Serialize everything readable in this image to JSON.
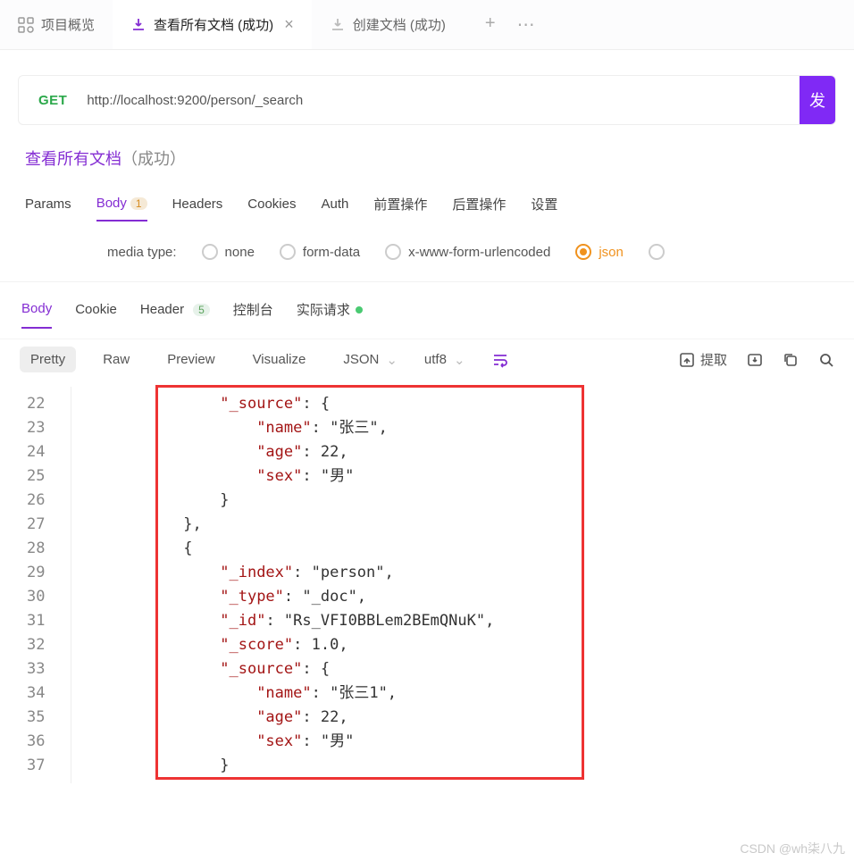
{
  "tabs": {
    "overview": "项目概览",
    "active": "查看所有文档 (成功)",
    "third": "创建文档 (成功)"
  },
  "request": {
    "method": "GET",
    "url": "http://localhost:9200/person/_search",
    "send": "发"
  },
  "name": {
    "main": "查看所有文档",
    "suffix": "（成功）"
  },
  "reqTabs": {
    "params": "Params",
    "body": "Body",
    "bodyBadge": "1",
    "headers": "Headers",
    "cookies": "Cookies",
    "auth": "Auth",
    "pre": "前置操作",
    "post": "后置操作",
    "settings": "设置"
  },
  "media": {
    "label": "media type:",
    "none": "none",
    "formdata": "form-data",
    "xwww": "x-www-form-urlencoded",
    "json": "json"
  },
  "respTabs": {
    "body": "Body",
    "cookie": "Cookie",
    "header": "Header",
    "headerBadge": "5",
    "console": "控制台",
    "actual": "实际请求"
  },
  "toolbar": {
    "pretty": "Pretty",
    "raw": "Raw",
    "preview": "Preview",
    "visualize": "Visualize",
    "format": "JSON",
    "encoding": "utf8",
    "extract": "提取"
  },
  "code": {
    "startLine": 22,
    "lines": [
      "                \"_source\": {",
      "                    \"name\": \"张三\",",
      "                    \"age\": 22,",
      "                    \"sex\": \"男\"",
      "                }",
      "            },",
      "            {",
      "                \"_index\": \"person\",",
      "                \"_type\": \"_doc\",",
      "                \"_id\": \"Rs_VFI0BBLem2BEmQNuK\",",
      "                \"_score\": 1.0,",
      "                \"_source\": {",
      "                    \"name\": \"张三1\",",
      "                    \"age\": 22,",
      "                    \"sex\": \"男\"",
      "                }"
    ]
  },
  "watermark": "CSDN @wh柒八九"
}
